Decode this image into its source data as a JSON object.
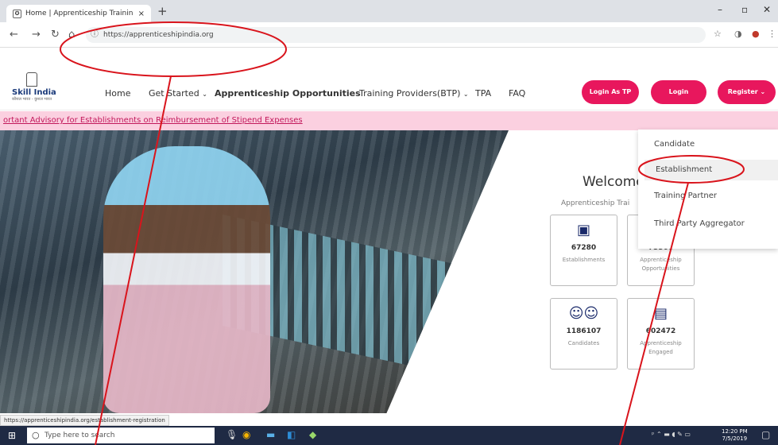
{
  "browser": {
    "tab_title": "Home | Apprenticeship Training",
    "tab_close": "×",
    "new_tab": "+",
    "url": "https://apprenticeshipindia.org",
    "status_url": "https://apprenticeshipindia.org/establishment-registration"
  },
  "site": {
    "logo_name": "Skill India",
    "logo_sub": "कौशल भारत - कुशल भारत",
    "nav": [
      {
        "label": "Home"
      },
      {
        "label": "Get Started"
      },
      {
        "label": "Apprenticeship Opportunities"
      },
      {
        "label": "Training Providers(BTP)"
      },
      {
        "label": "TPA"
      },
      {
        "label": "FAQ"
      }
    ],
    "buttons": {
      "login_tp": "Login As TP",
      "login": "Login",
      "register": "Register"
    },
    "ticker": "ortant Advisory for Establishments on Reimbursement of Stipend Expenses"
  },
  "hero": {
    "welcome": "Welcome",
    "subtitle": "Apprenticeship Trai",
    "cards": [
      {
        "number": "67280",
        "label": "Establishments",
        "icon": "building-icon"
      },
      {
        "number": "73500",
        "label": "Apprenticeship Opportunities",
        "icon": "briefcase-icon"
      },
      {
        "number": "1186107",
        "label": "Candidates",
        "icon": "users-icon"
      },
      {
        "number": "602472",
        "label": "Apprenticeship Engaged",
        "icon": "briefcase-icon"
      }
    ]
  },
  "register_menu": {
    "items": [
      {
        "label": "Candidate"
      },
      {
        "label": "Establishment"
      },
      {
        "label": "Training Partner"
      },
      {
        "label": "Third Party Aggregator"
      }
    ]
  },
  "taskbar": {
    "search_placeholder": "Type here to search",
    "time": "12:20 PM",
    "date": "7/5/2019"
  },
  "annotation_color": "#d9141c",
  "accent": "#e8175d"
}
